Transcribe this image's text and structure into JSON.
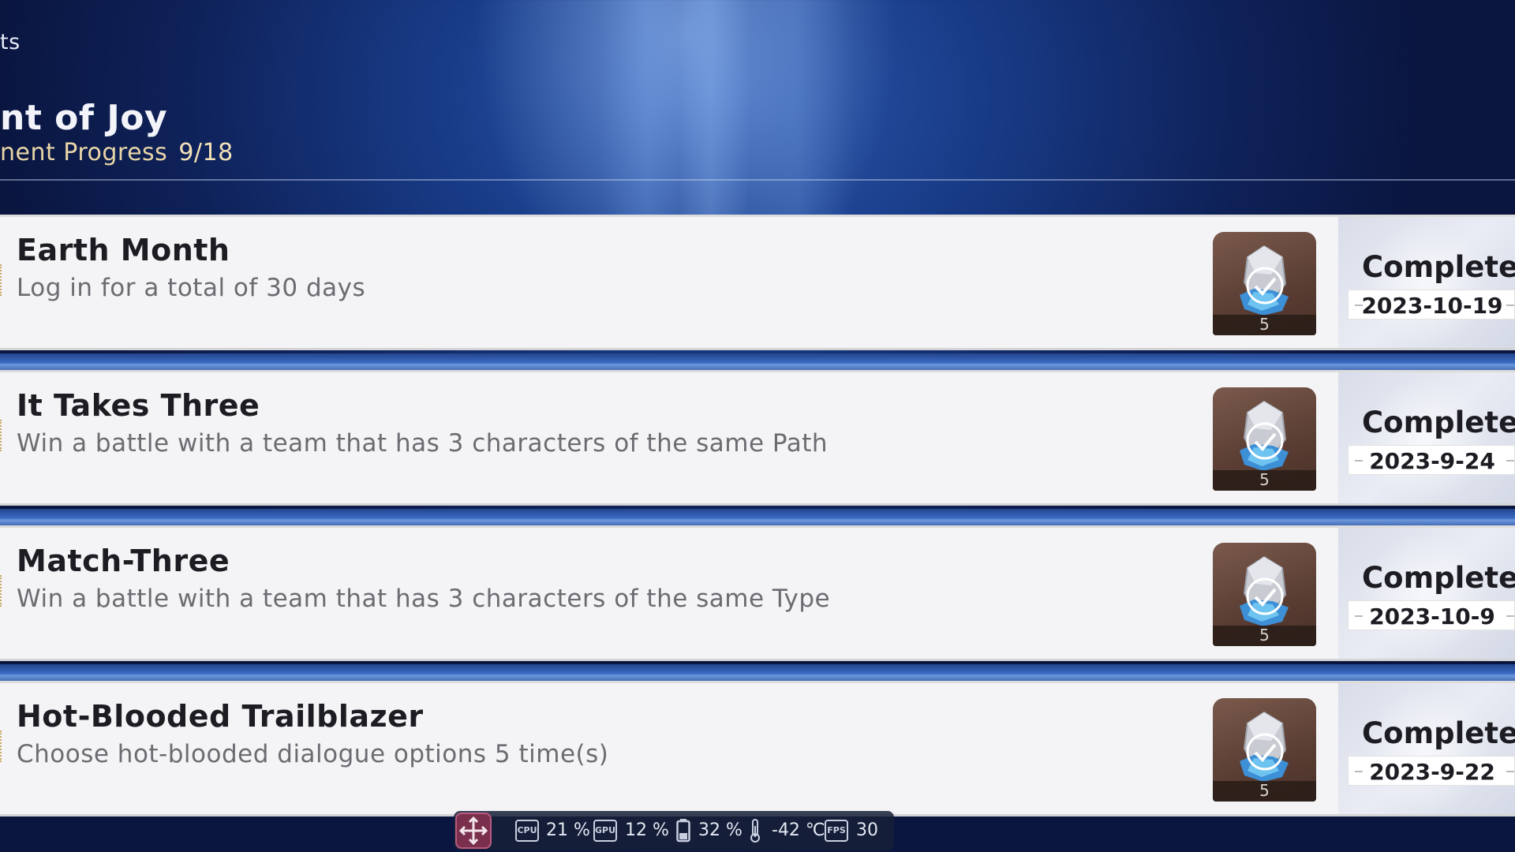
{
  "header": {
    "crumb": "ts",
    "title": "nt of Joy",
    "progress_label": "nent Progress",
    "progress_count": "9/18"
  },
  "achievements": [
    {
      "name": "Earth Month",
      "description": "Log in for a total of 30 days",
      "reward_qty": "5",
      "status": "Completed",
      "date": "2023-10-19"
    },
    {
      "name": "It Takes Three",
      "description": "Win a battle with a team that has 3 characters of the same Path",
      "reward_qty": "5",
      "status": "Completed",
      "date": "2023-9-24"
    },
    {
      "name": "Match-Three",
      "description": "Win a battle with a team that has 3 characters of the same Type",
      "reward_qty": "5",
      "status": "Completed",
      "date": "2023-10-9"
    },
    {
      "name": "Hot-Blooded Trailblazer",
      "description": "Choose hot-blooded dialogue options 5 time(s)",
      "reward_qty": "5",
      "status": "Completed",
      "date": "2023-9-22"
    }
  ],
  "overlay": {
    "cpu_label": "CPU",
    "cpu": "21 %",
    "gpu_label": "GPU",
    "gpu": "12 %",
    "battery": "32 %",
    "temperature": "-42 ℃",
    "fps_label": "FPS",
    "fps": "30"
  },
  "colors": {
    "progress_gold": "#e9d6a8",
    "card_bg": "#f4f4f6",
    "reward_bg": "#5a3d33",
    "overlay_move": "#7a2f4c"
  }
}
